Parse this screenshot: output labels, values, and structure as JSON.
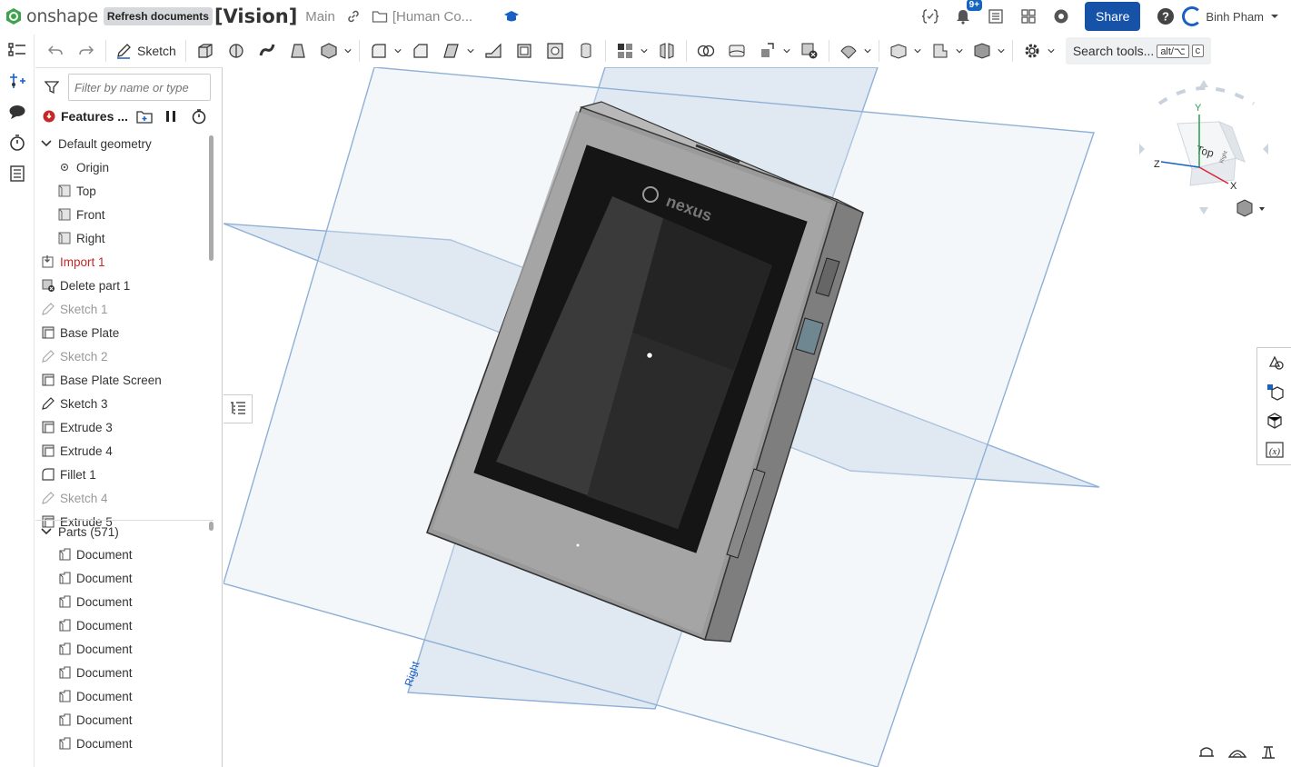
{
  "app": {
    "logo_text": "onshape",
    "refresh_label": "Refresh documents",
    "document_title": "[Vision]",
    "branch": "Main",
    "folder_path": "[Human Co...",
    "notification_count": "9+",
    "share_label": "Share",
    "user_name": "Binh Pham"
  },
  "toolbar": {
    "sketch_label": "Sketch",
    "search_label": "Search tools...",
    "shortcut_keys": [
      "alt/⌥",
      "c"
    ]
  },
  "feature_panel": {
    "filter_placeholder": "Filter by name or type",
    "features_label": "Features ...",
    "items": [
      {
        "label": "Default geometry",
        "kind": "group"
      },
      {
        "label": "Origin",
        "kind": "origin"
      },
      {
        "label": "Top",
        "kind": "plane"
      },
      {
        "label": "Front",
        "kind": "plane"
      },
      {
        "label": "Right",
        "kind": "plane"
      },
      {
        "label": "Import 1",
        "kind": "import-error"
      },
      {
        "label": "Delete part 1",
        "kind": "delete"
      },
      {
        "label": "Sketch 1",
        "kind": "sketch"
      },
      {
        "label": "Base Plate",
        "kind": "extrude"
      },
      {
        "label": "Sketch 2",
        "kind": "sketch"
      },
      {
        "label": "Base Plate Screen",
        "kind": "extrude"
      },
      {
        "label": "Sketch 3",
        "kind": "sketch-active"
      },
      {
        "label": "Extrude 3",
        "kind": "extrude"
      },
      {
        "label": "Extrude 4",
        "kind": "extrude"
      },
      {
        "label": "Fillet 1",
        "kind": "fillet"
      },
      {
        "label": "Sketch 4",
        "kind": "sketch"
      },
      {
        "label": "Extrude 5",
        "kind": "extrude"
      }
    ],
    "parts_label": "Parts (571)",
    "parts": [
      "Document",
      "Document",
      "Document",
      "Document",
      "Document",
      "Document",
      "Document",
      "Document",
      "Document"
    ]
  },
  "viewport": {
    "plane_label_right": "Right",
    "device_brand": "nexus",
    "view_cube": {
      "face_top": "Top",
      "face_right": "Right",
      "axis_x": "X",
      "axis_y": "Y",
      "axis_z": "Z"
    }
  },
  "colors": {
    "accent": "#1552a8",
    "plane_fill": "#c9d9ea",
    "plane_edge": "#8fb0d6",
    "error_red": "#c62828"
  }
}
